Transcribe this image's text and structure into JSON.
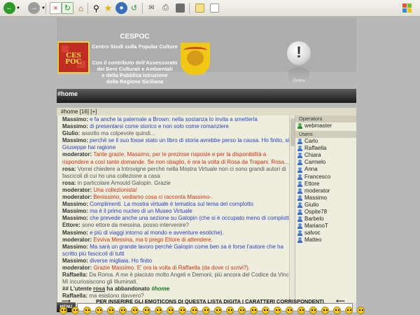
{
  "header": {
    "title": "CESPOC",
    "subtitle_line1": "Centro Studi sulla Popular Culture",
    "desc_lines": [
      "Con il contributo dell'Assessorato",
      "dei Beni Culturali e Ambientali",
      "e della Pubblica Istruzione",
      "della Regione Siciliana"
    ],
    "logo_text": "CES POC",
    "online_label": "Online"
  },
  "tab": {
    "home_label": "#home"
  },
  "channel": {
    "label": "#home [16] [+]"
  },
  "chat": {
    "messages": [
      {
        "nick": "Massimo:",
        "text": "e fa anche la paternale a Brown: nella sostanza lo invita a smetterla",
        "color": "blue"
      },
      {
        "nick": "Massimo:",
        "text": "di presentarsi come storico e non solo come romanziere",
        "color": "blue"
      },
      {
        "nick": "Giulio:",
        "text": "assolto ma colpevole quindi...",
        "color": "gray"
      },
      {
        "nick": "Massimo:",
        "text": "perchè se il suo fosse stato un libro di storia avrebbe perso la causa. Ho finito, si Giuseppe hai ragione",
        "color": "blue"
      },
      {
        "nick": "moderator:",
        "text": "Tante grazie, Massimo, per le preziose risposte e per la disponibilità a rispondere a così tante domande. Se non sbaglio, è ora la volta di Rosa da Trapani. Rosa...",
        "color": "red"
      },
      {
        "nick": "rosa:",
        "text": "Vorrei chiedere a Introvigne perchè nella Mostra Virtuale non ci sono grandi autori di fascicoli di cui ho una collezione a casa",
        "color": "gray"
      },
      {
        "nick": "rosa:",
        "text": "in particolare Arnould Galopin. Grazie",
        "color": "gray"
      },
      {
        "nick": "moderator:",
        "text": "Una collezionista!",
        "color": "red"
      },
      {
        "nick": "moderator:",
        "text": "Benissimo, vediamo cosa ci racconta Massimo-.",
        "color": "red"
      },
      {
        "nick": "Massimo:",
        "text": "Complimenti. La mostra virtuale è tematica sul tema del complotto",
        "color": "blue"
      },
      {
        "nick": "Massimo:",
        "text": "ma è il primo nucleo di un Museo Virtuale",
        "color": "blue"
      },
      {
        "nick": "Massimo:",
        "text": "che prevede anche una sezione su Galopin (che si è occupato meno di complotti",
        "color": "blue"
      },
      {
        "nick": "Ettore:",
        "text": "sono ettore da messina. posso intervenire?",
        "color": "gray"
      },
      {
        "nick": "Massimo:",
        "text": "e più di viaggi intorno al mondo e avventure esotiche).",
        "color": "blue"
      },
      {
        "nick": "moderator:",
        "text": "Evviva Messina, ma ti prego Ettore di attendere.",
        "color": "red"
      },
      {
        "nick": "Massimo:",
        "text": "Ma sarà un grande lavoro perchè Galopin come ben sa è forse l'autore che ha scritto più fascicoli di tutti",
        "color": "blue"
      },
      {
        "nick": "Massimo:",
        "text": "diverse migliaia. Ho finito",
        "color": "blue"
      },
      {
        "nick": "moderator:",
        "text": "Grazie Massimo. E' ora la volta di Raffaella (da dove ci scrivi?).",
        "color": "red"
      },
      {
        "nick": "Raffaella:",
        "text": "Da Roma. A me è piaciuto molto Angeli e Demoni, più ancora del Codice da Vinci. Mi incuriosiscono gli Illuminati.",
        "color": "gray"
      }
    ],
    "exit_prefix": "## L'utente",
    "exit_user": "rosa",
    "exit_mid": "ha abbandonato",
    "exit_channel": "#home",
    "last": {
      "nick": "Raffaella:",
      "text": "ma esistono davvero?",
      "color": "gray"
    }
  },
  "users_panel": {
    "operators_label": "Operators",
    "operators": [
      "webmaster"
    ],
    "users_label": "Users",
    "users": [
      "Carlo",
      "Raffaella",
      "Chiara",
      "Carmelo",
      "Anna",
      "Francesco",
      "Ettore",
      "moderator",
      "Massimo",
      "Giulio",
      "Ospite78",
      "Barbelo",
      "MarianoT",
      "salvoc",
      "Matteo"
    ]
  },
  "input": {
    "menu_label": "MENU",
    "value": ""
  },
  "emoticons": {
    "instruction": "PER INSERIRE GLI EMOTICONS DI QUESTA LISTA DIGITA I CARATTERI CORRISPONDENTI"
  },
  "colors": {
    "blue": "#2b3fc4",
    "red": "#d43210",
    "gray": "#555555"
  }
}
